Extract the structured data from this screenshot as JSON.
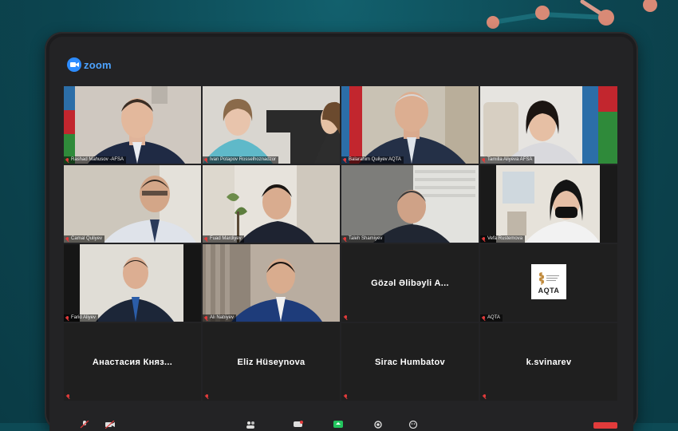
{
  "app": {
    "name": "zoom"
  },
  "colors": {
    "zoom_blue": "#2d8cff",
    "muted_red": "#e23b3b",
    "tile_bg": "#1f1f1f"
  },
  "participants": [
    {
      "name": "Rashad Mahusov -AFSA",
      "video": true
    },
    {
      "name": "Ivan Potapov Rosselhoznadzor",
      "video": true
    },
    {
      "name": "Balarahim Quliyev AQTA",
      "video": true
    },
    {
      "name": "Tamilla Aliyeva AFSA",
      "video": true
    },
    {
      "name": "Camal Quliyev",
      "video": true
    },
    {
      "name": "Fuad Mardiyev",
      "video": true
    },
    {
      "name": "Taleh Shamiyev",
      "video": true
    },
    {
      "name": "Vefa Rustemova",
      "video": true
    },
    {
      "name": "Farid Aliyev",
      "video": true
    },
    {
      "name": "Ali Nabiyev",
      "video": true
    },
    {
      "name": "Gözəl Əlibəyli A...",
      "video": false
    },
    {
      "name": "AQTA",
      "video": false,
      "logo_text": "AQTA"
    },
    {
      "name": "Анастасия  Княз...",
      "video": false
    },
    {
      "name": "Eliz Hüseynova",
      "video": false
    },
    {
      "name": "Sirac Humbatov",
      "video": false
    },
    {
      "name": "k.svinarev",
      "video": false
    }
  ],
  "toolbar": {
    "items": [
      "mute-icon",
      "stop-video-icon",
      "participants-icon",
      "chat-icon",
      "share-screen-icon",
      "record-icon",
      "reactions-icon",
      "end-button"
    ]
  }
}
